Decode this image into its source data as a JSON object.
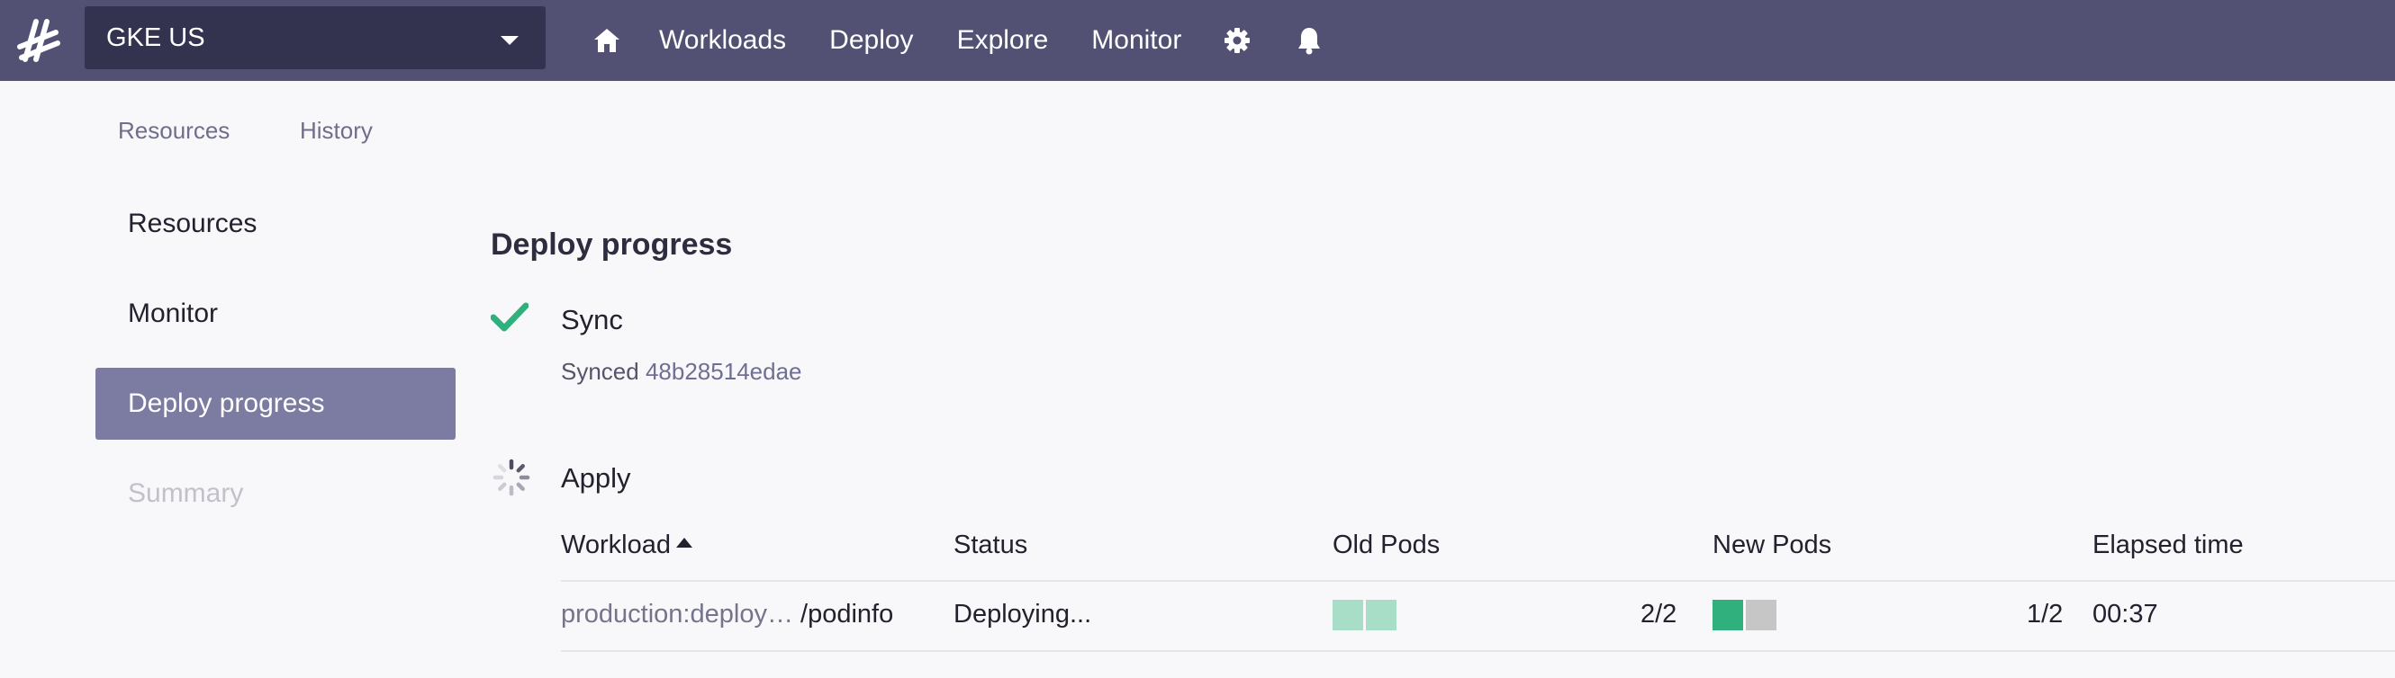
{
  "header": {
    "env_select": "GKE US",
    "nav": [
      "Workloads",
      "Deploy",
      "Explore",
      "Monitor"
    ],
    "icons": [
      "logo-icon",
      "home-icon",
      "gear-icon",
      "bell-icon"
    ]
  },
  "subtabs": [
    "Resources",
    "History"
  ],
  "sidebar": {
    "items": [
      {
        "label": "Resources",
        "state": "normal"
      },
      {
        "label": "Monitor",
        "state": "normal"
      },
      {
        "label": "Deploy progress",
        "state": "active"
      },
      {
        "label": "Summary",
        "state": "disabled"
      }
    ]
  },
  "main": {
    "title": "Deploy progress",
    "sync": {
      "label": "Sync",
      "synced_prefix": "Synced",
      "commit": "48b28514edae"
    },
    "apply": {
      "label": "Apply"
    },
    "table": {
      "headers": [
        "Workload",
        "Status",
        "Old Pods",
        "New Pods",
        "Elapsed time"
      ],
      "sort_column": "Workload",
      "rows": [
        {
          "workload_prefix": "production:deploy…",
          "workload_name": "/podinfo",
          "status": "Deploying...",
          "old_pods": "2/2",
          "new_pods": "1/2",
          "elapsed": "00:37"
        }
      ]
    }
  },
  "colors": {
    "topbar": "#525174",
    "env_select": "#34334f",
    "active_item": "#7c7ba1",
    "success": "#2fb07d",
    "pod_old": "#a8ddc8",
    "pod_ready": "#2fb07d",
    "pod_pending": "#c6c6c6"
  }
}
